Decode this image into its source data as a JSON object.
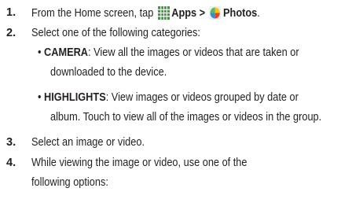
{
  "step1": {
    "number": "1.",
    "prefix": "From the Home screen, tap",
    "apps_label": "Apps >",
    "photos_label": "Photos",
    "end": ".",
    "apps_icon": "apps-grid-icon",
    "photos_icon": "photos-pinwheel-icon"
  },
  "step2": {
    "number": "2.",
    "text": "Select one of the following categories:"
  },
  "bullet1": {
    "symbol": "•",
    "term": "CAMERA",
    "text_line1": ": View all the images or videos that are taken or",
    "text_line2": "downloaded to the device."
  },
  "bullet2": {
    "symbol": "•",
    "term": "HIGHLIGHTS",
    "text_line1": ": View images or videos grouped by date or",
    "text_line2": "album. Touch to view all of the images or videos in the group."
  },
  "step3": {
    "number": "3.",
    "text": "Select an image or video."
  },
  "step4": {
    "number": "4.",
    "text_line1": "While viewing the image or video, use one of the",
    "text_line2": "following options:"
  },
  "colors": {
    "text": "#231f20",
    "apps_icon": "#3a9a3a",
    "photos_icon_colors": [
      "#f5c518",
      "#e8412c",
      "#2f8fd8",
      "#5cb85c"
    ]
  }
}
